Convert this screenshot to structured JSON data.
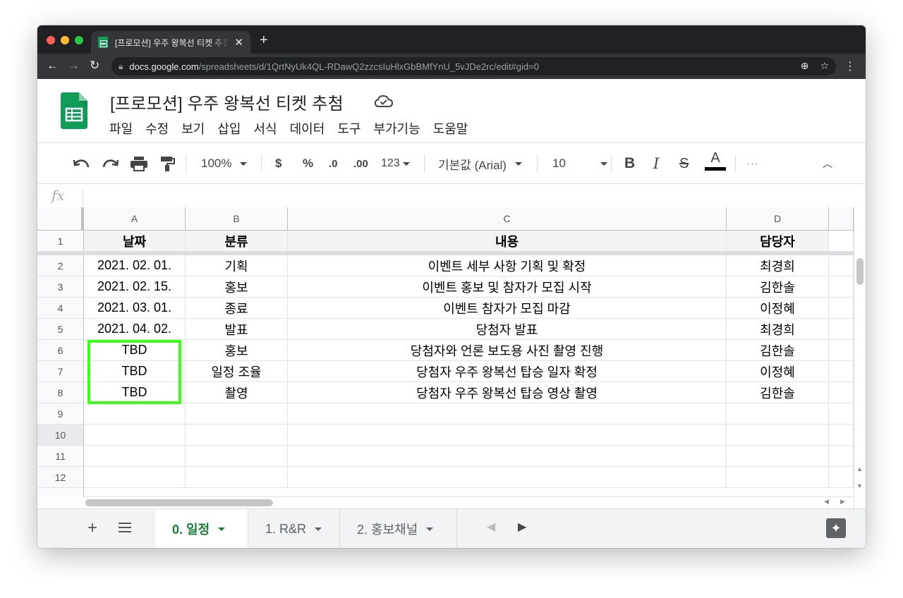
{
  "browser": {
    "tab_title": "[프로모션] 우주 왕복선 티켓 추첨 - Google",
    "tab_close": "✕",
    "new_tab": "+",
    "url_host": "docs.google.com",
    "url_path": "/spreadsheets/d/1QrtNyUk4QL-RDawQ2zzcsIuHlxGbBMfYnU_5vJDe2rc/edit#gid=0"
  },
  "doc": {
    "title": "[프로모션] 우주 왕복선 티켓 추첨",
    "menu": [
      "파일",
      "수정",
      "보기",
      "삽입",
      "서식",
      "데이터",
      "도구",
      "부가기능",
      "도움말"
    ]
  },
  "toolbar": {
    "zoom": "100%",
    "currency": "$",
    "percent": "%",
    "dec_decrease": ".0",
    "dec_increase": ".00",
    "more_formats": "123",
    "font": "기본값 (Arial)",
    "font_size": "10",
    "bold": "B",
    "italic": "I",
    "strike": "S",
    "text_color": "A",
    "more": "···"
  },
  "formula_bar": {
    "fx": "fx",
    "value": ""
  },
  "grid": {
    "columns": [
      "A",
      "B",
      "C",
      "D"
    ],
    "rows": [
      {
        "num": "1",
        "cells": [
          "날짜",
          "분류",
          "내용",
          "담당자"
        ]
      },
      {
        "num": "2",
        "cells": [
          "2021. 02. 01.",
          "기획",
          "이벤트 세부 사항 기획 및 확정",
          "최경희"
        ]
      },
      {
        "num": "3",
        "cells": [
          "2021. 02. 15.",
          "홍보",
          "이벤트 홍보 및 참자가 모집 시작",
          "김한솔"
        ]
      },
      {
        "num": "4",
        "cells": [
          "2021. 03. 01.",
          "종료",
          "이벤트 참자가 모집 마감",
          "이정혜"
        ]
      },
      {
        "num": "5",
        "cells": [
          "2021. 04. 02.",
          "발표",
          "당첨자 발표",
          "최경희"
        ]
      },
      {
        "num": "6",
        "cells": [
          "TBD",
          "홍보",
          "당첨자와 언론 보도용 사진 촬영 진행",
          "김한솔"
        ]
      },
      {
        "num": "7",
        "cells": [
          "TBD",
          "일정 조율",
          "당첨자 우주 왕복선 탑승 일자 확정",
          "이정혜"
        ]
      },
      {
        "num": "8",
        "cells": [
          "TBD",
          "촬영",
          "당첨자 우주 왕복선 탑승 영상 촬영",
          "김한솔"
        ]
      },
      {
        "num": "9",
        "cells": [
          "",
          "",
          "",
          ""
        ]
      },
      {
        "num": "10",
        "cells": [
          "",
          "",
          "",
          ""
        ]
      },
      {
        "num": "11",
        "cells": [
          "",
          "",
          "",
          ""
        ]
      },
      {
        "num": "12",
        "cells": [
          "",
          "",
          "",
          ""
        ]
      }
    ],
    "highlight_color": "#3cff1a"
  },
  "sheets": {
    "add": "+",
    "tabs": [
      "0. 일정",
      "1. R&R",
      "2. 홍보채널"
    ],
    "active_index": 0,
    "active_color": "#188038",
    "explore": "✦"
  }
}
